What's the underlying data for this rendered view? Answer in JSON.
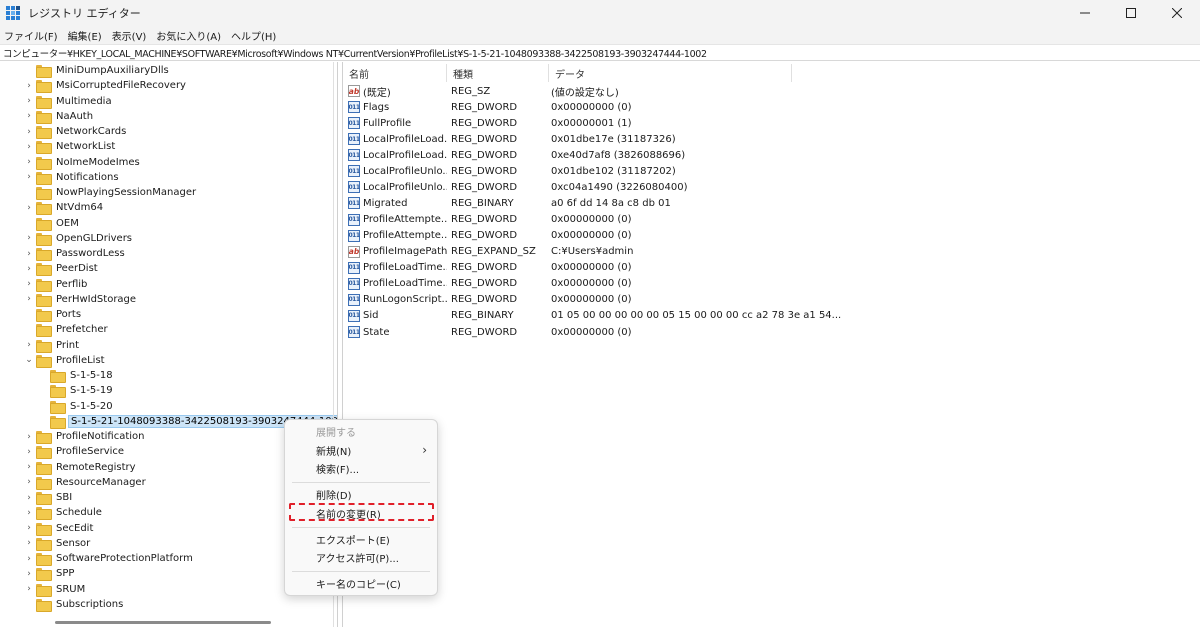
{
  "window": {
    "title": "レジストリ エディター",
    "minimize": "—",
    "maximize": "☐",
    "close": "✕"
  },
  "menu": [
    "ファイル(F)",
    "編集(E)",
    "表示(V)",
    "お気に入り(A)",
    "ヘルプ(H)"
  ],
  "address": "コンピューター¥HKEY_LOCAL_MACHINE¥SOFTWARE¥Microsoft¥Windows NT¥CurrentVersion¥ProfileList¥S-1-5-21-1048093388-3422508193-3903247444-1002",
  "tree": {
    "items": [
      {
        "label": "MiniDumpAuxiliaryDlls",
        "chevron": ""
      },
      {
        "label": "MsiCorruptedFileRecovery",
        "chevron": "›"
      },
      {
        "label": "Multimedia",
        "chevron": "›"
      },
      {
        "label": "NaAuth",
        "chevron": "›"
      },
      {
        "label": "NetworkCards",
        "chevron": "›"
      },
      {
        "label": "NetworkList",
        "chevron": "›"
      },
      {
        "label": "NoImeModeImes",
        "chevron": "›"
      },
      {
        "label": "Notifications",
        "chevron": "›"
      },
      {
        "label": "NowPlayingSessionManager",
        "chevron": ""
      },
      {
        "label": "NtVdm64",
        "chevron": "›"
      },
      {
        "label": "OEM",
        "chevron": ""
      },
      {
        "label": "OpenGLDrivers",
        "chevron": "›"
      },
      {
        "label": "PasswordLess",
        "chevron": "›"
      },
      {
        "label": "PeerDist",
        "chevron": "›"
      },
      {
        "label": "Perflib",
        "chevron": "›"
      },
      {
        "label": "PerHwIdStorage",
        "chevron": "›"
      },
      {
        "label": "Ports",
        "chevron": ""
      },
      {
        "label": "Prefetcher",
        "chevron": ""
      },
      {
        "label": "Print",
        "chevron": "›"
      },
      {
        "label": "ProfileList",
        "chevron": "⌄"
      },
      {
        "label": "S-1-5-18",
        "chevron": ""
      },
      {
        "label": "S-1-5-19",
        "chevron": ""
      },
      {
        "label": "S-1-5-20",
        "chevron": ""
      },
      {
        "label": "S-1-5-21-1048093388-3422508193-3903247444-1002",
        "chevron": ""
      },
      {
        "label": "ProfileNotification",
        "chevron": "›"
      },
      {
        "label": "ProfileService",
        "chevron": "›"
      },
      {
        "label": "RemoteRegistry",
        "chevron": "›"
      },
      {
        "label": "ResourceManager",
        "chevron": "›"
      },
      {
        "label": "SBI",
        "chevron": "›"
      },
      {
        "label": "Schedule",
        "chevron": "›"
      },
      {
        "label": "SecEdit",
        "chevron": "›"
      },
      {
        "label": "Sensor",
        "chevron": "›"
      },
      {
        "label": "SoftwareProtectionPlatform",
        "chevron": "›"
      },
      {
        "label": "SPP",
        "chevron": "›"
      },
      {
        "label": "SRUM",
        "chevron": "›"
      },
      {
        "label": "Subscriptions",
        "chevron": ""
      }
    ]
  },
  "list": {
    "headers": {
      "name": "名前",
      "type": "種類",
      "data": "データ"
    },
    "rows": [
      {
        "name": "(既定)",
        "type": "REG_SZ",
        "data": "(値の設定なし)",
        "icon": "string-value-icon"
      },
      {
        "name": "Flags",
        "type": "REG_DWORD",
        "data": "0x00000000 (0)",
        "icon": "binary-value-icon"
      },
      {
        "name": "FullProfile",
        "type": "REG_DWORD",
        "data": "0x00000001 (1)",
        "icon": "binary-value-icon"
      },
      {
        "name": "LocalProfileLoad...",
        "type": "REG_DWORD",
        "data": "0x01dbe17e (31187326)",
        "icon": "binary-value-icon"
      },
      {
        "name": "LocalProfileLoad...",
        "type": "REG_DWORD",
        "data": "0xe40d7af8 (3826088696)",
        "icon": "binary-value-icon"
      },
      {
        "name": "LocalProfileUnlo...",
        "type": "REG_DWORD",
        "data": "0x01dbe102 (31187202)",
        "icon": "binary-value-icon"
      },
      {
        "name": "LocalProfileUnlo...",
        "type": "REG_DWORD",
        "data": "0xc04a1490 (3226080400)",
        "icon": "binary-value-icon"
      },
      {
        "name": "Migrated",
        "type": "REG_BINARY",
        "data": "a0 6f dd 14 8a c8 db 01",
        "icon": "binary-value-icon"
      },
      {
        "name": "ProfileAttempte...",
        "type": "REG_DWORD",
        "data": "0x00000000 (0)",
        "icon": "binary-value-icon"
      },
      {
        "name": "ProfileAttempte...",
        "type": "REG_DWORD",
        "data": "0x00000000 (0)",
        "icon": "binary-value-icon"
      },
      {
        "name": "ProfileImagePath",
        "type": "REG_EXPAND_SZ",
        "data": "C:¥Users¥admin",
        "icon": "string-value-icon"
      },
      {
        "name": "ProfileLoadTime...",
        "type": "REG_DWORD",
        "data": "0x00000000 (0)",
        "icon": "binary-value-icon"
      },
      {
        "name": "ProfileLoadTime...",
        "type": "REG_DWORD",
        "data": "0x00000000 (0)",
        "icon": "binary-value-icon"
      },
      {
        "name": "RunLogonScript...",
        "type": "REG_DWORD",
        "data": "0x00000000 (0)",
        "icon": "binary-value-icon"
      },
      {
        "name": "Sid",
        "type": "REG_BINARY",
        "data": "01 05 00 00 00 00 00 05 15 00 00 00 cc a2 78 3e a1 54...",
        "icon": "binary-value-icon"
      },
      {
        "name": "State",
        "type": "REG_DWORD",
        "data": "0x00000000 (0)",
        "icon": "binary-value-icon"
      }
    ]
  },
  "context_menu": {
    "expand": "展開する",
    "new": "新規(N)",
    "new_arrow": "›",
    "find": "検索(F)...",
    "delete": "削除(D)",
    "rename": "名前の変更(R)",
    "export": "エクスポート(E)",
    "permissions": "アクセス許可(P)...",
    "copy_key_name": "キー名のコピー(C)"
  },
  "colors": {
    "selection": "#cce4f7",
    "highlight": "#e0202a",
    "folder": "#f2c94c"
  }
}
